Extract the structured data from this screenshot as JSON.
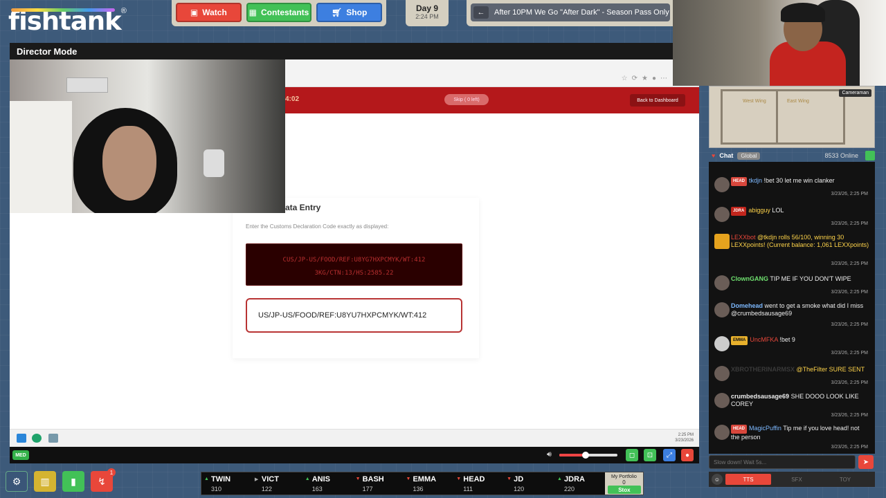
{
  "brand": {
    "logo_text": "fishtank",
    "registered": "®"
  },
  "nav": {
    "watch": "Watch",
    "contestants": "Contestants",
    "shop": "Shop"
  },
  "day": {
    "label": "Day 9",
    "time": "2:24 PM"
  },
  "ticker_text": "After 10PM We Go \"After Dark\" - Season Pass Only",
  "director_mode": "Director Mode",
  "screen": {
    "timer": "4:02",
    "skip_label": "Skip ( 0 left)",
    "dashboard_label": "Back to Dashboard",
    "form_title": "ata Entry",
    "instruction": "Enter the Customs Declaration Code exactly as displayed:",
    "code_line1": "CUS/JP-US/FOOD/REF:U8YG7HXPCMYK/WT:412",
    "code_line2": "3KG/CTN:13/HS:2585.22",
    "input_value": "US/JP-US/FOOD/REF:U8YU7HXPCMYK/WT:412",
    "taskbar_time": "2:25 PM",
    "taskbar_date": "3/23/2026"
  },
  "media": {
    "badge": "MED",
    "volume": 0.45
  },
  "map": {
    "cameraman": "Cameraman",
    "west_wing": "West Wing",
    "east_wing": "East Wing"
  },
  "chat": {
    "title": "Chat",
    "tab_global": "Global",
    "online": "8533 Online",
    "input_placeholder": "Slow down! Wait 5s...",
    "messages": [
      {
        "badge": "HEAD",
        "user": "tkdjn",
        "text": "!bet 30 let me win clanker",
        "time": "3/23/26, 2:25 PM"
      },
      {
        "badge": "JDRA",
        "user": "abigguy",
        "text": "LOL",
        "time": "3/23/26, 2:25 PM"
      },
      {
        "badge": "",
        "user": "LEXXbot",
        "text": "@tkdjn rolls 56/100, winning 30 LEXXpoints! (Current balance: 1,061 LEXXpoints)",
        "time": "3/23/26, 2:25 PM"
      },
      {
        "badge": "",
        "user": "ClownGANG",
        "text": "TIP ME IF YOU DON'T WIPE",
        "time": "3/23/26, 2:25 PM"
      },
      {
        "badge": "",
        "user": "Domehead",
        "text": "went to get a smoke what did I miss @crumbedsausage69",
        "time": "3/23/26, 2:25 PM"
      },
      {
        "badge": "EMMA",
        "user": "UncMFKA",
        "text": "!bet 9",
        "time": "3/23/26, 2:25 PM"
      },
      {
        "badge": "",
        "user": "XBROTHERINARMSX",
        "text": "@TheFilter SURE SENT",
        "time": "3/23/26, 2:25 PM"
      },
      {
        "badge": "",
        "user": "crumbedsausage69",
        "text": "SHE DOOO LOOK LIKE COREY",
        "time": "3/23/26, 2:25 PM"
      },
      {
        "badge": "HEAD",
        "user": "MagicPuffin",
        "text": "Tip me if you love head! not the person",
        "time": "3/23/26, 2:25 PM"
      }
    ],
    "footer": {
      "tts": "TTS",
      "sfx": "SFX",
      "toy": "TOY"
    }
  },
  "stocks": [
    {
      "sym": "TWIN",
      "val": "310",
      "dir": "up"
    },
    {
      "sym": "VICT",
      "val": "122",
      "dir": "flat"
    },
    {
      "sym": "ANIS",
      "val": "163",
      "dir": "up"
    },
    {
      "sym": "BASH",
      "val": "177",
      "dir": "down"
    },
    {
      "sym": "EMMA",
      "val": "136",
      "dir": "down"
    },
    {
      "sym": "HEAD",
      "val": "111",
      "dir": "down"
    },
    {
      "sym": "JD",
      "val": "120",
      "dir": "down"
    },
    {
      "sym": "JDRA",
      "val": "220",
      "dir": "up"
    }
  ],
  "portfolio": {
    "label": "My Portfolio",
    "value": "0",
    "stox": "Stox"
  },
  "notification_count": "1",
  "colors": {
    "accent_red": "#e8473a",
    "accent_green": "#42c157",
    "accent_blue": "#3d7fe0",
    "app_header": "#b4181b"
  }
}
